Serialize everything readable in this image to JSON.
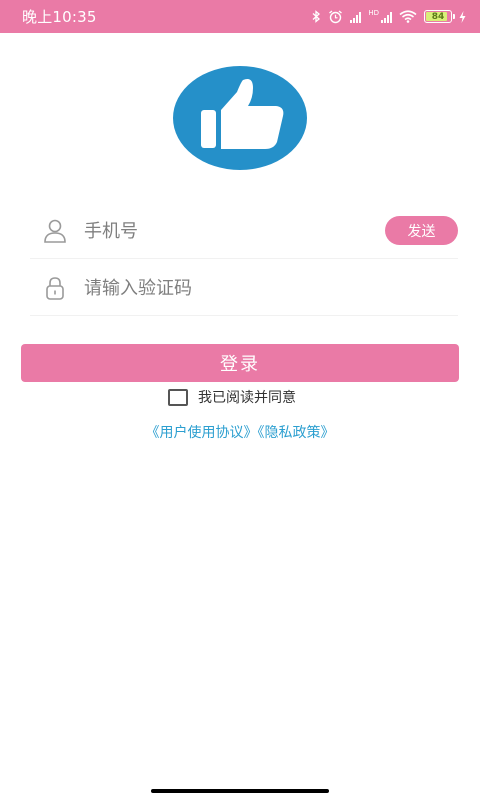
{
  "status_bar": {
    "time": "晚上10:35",
    "signal_label_1": "HD",
    "signal_label_2": "HD",
    "battery": "84",
    "accent_color": "#ea7aa6"
  },
  "logo": {
    "icon": "thumbs-up-icon",
    "color": "#2590c9"
  },
  "form": {
    "phone_placeholder": "手机号",
    "send_label": "发送",
    "code_placeholder": "请输入验证码",
    "phone_icon": "user-icon",
    "code_icon": "lock-icon"
  },
  "login": {
    "label": "登录"
  },
  "agreement": {
    "checked": false,
    "text": "我已阅读并同意",
    "user_agreement": "《用户使用协议》",
    "privacy_policy": "《隐私政策》",
    "link_color": "#2c9fd0"
  }
}
